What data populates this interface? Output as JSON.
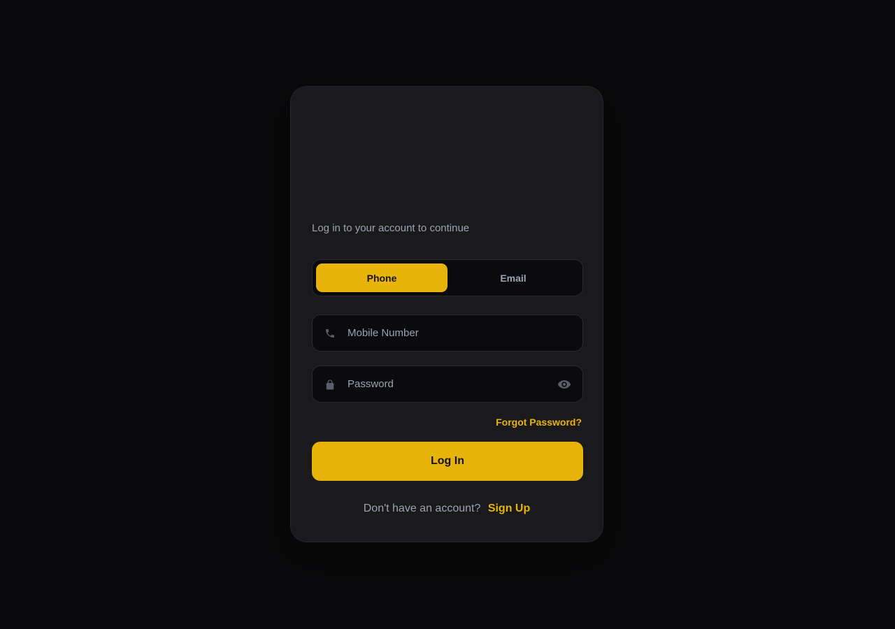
{
  "login": {
    "subtitle": "Log in to your account to continue",
    "tabs": [
      {
        "label": "Phone",
        "active": true
      },
      {
        "label": "Email",
        "active": false
      }
    ],
    "mobile": {
      "placeholder": "Mobile Number",
      "icon": "phone-icon"
    },
    "password": {
      "placeholder": "Password",
      "icon": "lock-icon",
      "toggle_icon": "eye-icon"
    },
    "forgot_label": "Forgot Password?",
    "login_label": "Log In",
    "signup_prompt": "Don't have an account?",
    "signup_label": "Sign Up"
  },
  "colors": {
    "background": "#0a0a0c",
    "card": "#1a1a1d",
    "accent": "#e8b30b",
    "muted_text": "#9ca3b0"
  }
}
